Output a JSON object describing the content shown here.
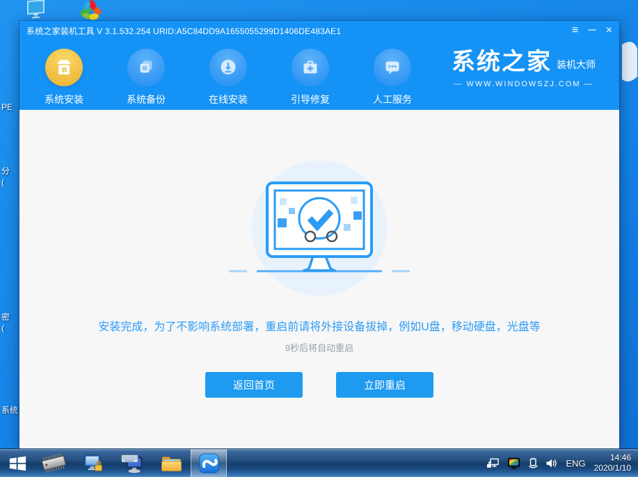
{
  "desktop": {
    "labels": [
      "PE",
      "分\n(",
      "密\n(",
      "系统"
    ]
  },
  "window": {
    "title": "系统之家装机工具 V 3.1.532.254 URID:A5C84DD9A1655055299D1406DE483AE1",
    "controls": {
      "menu_icon": "≡",
      "minimize_icon": "─",
      "close_icon": "×"
    },
    "nav": [
      {
        "label": "系统安装",
        "active": true
      },
      {
        "label": "系统备份",
        "active": false
      },
      {
        "label": "在线安装",
        "active": false
      },
      {
        "label": "引导修复",
        "active": false
      },
      {
        "label": "人工服务",
        "active": false
      }
    ],
    "logo": {
      "brand": "系统之家",
      "sub": "装机大师",
      "site": "—  WWW.WINDOWSZJ.COM  —"
    },
    "content": {
      "message": "安装完成，为了不影响系统部署，重启前请将外接设备拔掉，例如U盘，移动硬盘，光盘等",
      "countdown": "9秒后将自动重启",
      "btn_home": "返回首页",
      "btn_restart": "立即重启"
    }
  },
  "taskbar": {
    "language": "ENG",
    "time": "14:46",
    "date": "2020/1/10"
  },
  "colors": {
    "header_blue": "#1592f5",
    "active_nav_gold": "#eeb93a",
    "button_blue": "#1e9af0",
    "message_blue": "#2e9bf3",
    "desktop_blue": "#1583e6",
    "illustration_bg": "#e7f2fd"
  }
}
